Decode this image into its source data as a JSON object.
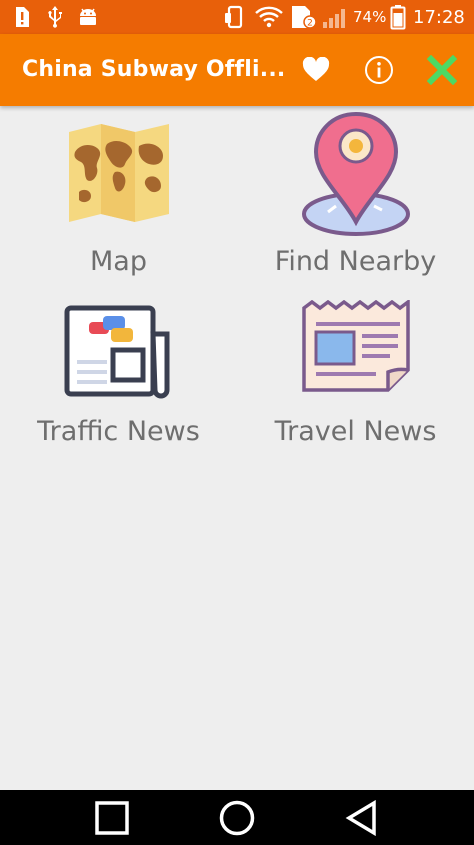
{
  "status_bar": {
    "battery_percent": "74%",
    "time": "17:28"
  },
  "app_bar": {
    "title": "China Subway Offli...",
    "favorite_icon": "heart-icon",
    "info_icon": "info-icon",
    "close_icon": "close-x-icon"
  },
  "grid": {
    "items": [
      {
        "label": "Map",
        "icon": "map-icon"
      },
      {
        "label": "Find Nearby",
        "icon": "location-pin-icon"
      },
      {
        "label": "Traffic News",
        "icon": "newspaper-traffic-icon"
      },
      {
        "label": "Travel News",
        "icon": "newspaper-icon"
      }
    ]
  },
  "nav_bar": {
    "recents_icon": "square-icon",
    "home_icon": "circle-icon",
    "back_icon": "triangle-back-icon"
  },
  "colors": {
    "status_bar": "#e8600a",
    "app_bar": "#f57c00",
    "close_icon": "#4cd964",
    "background": "#eeeeee"
  }
}
